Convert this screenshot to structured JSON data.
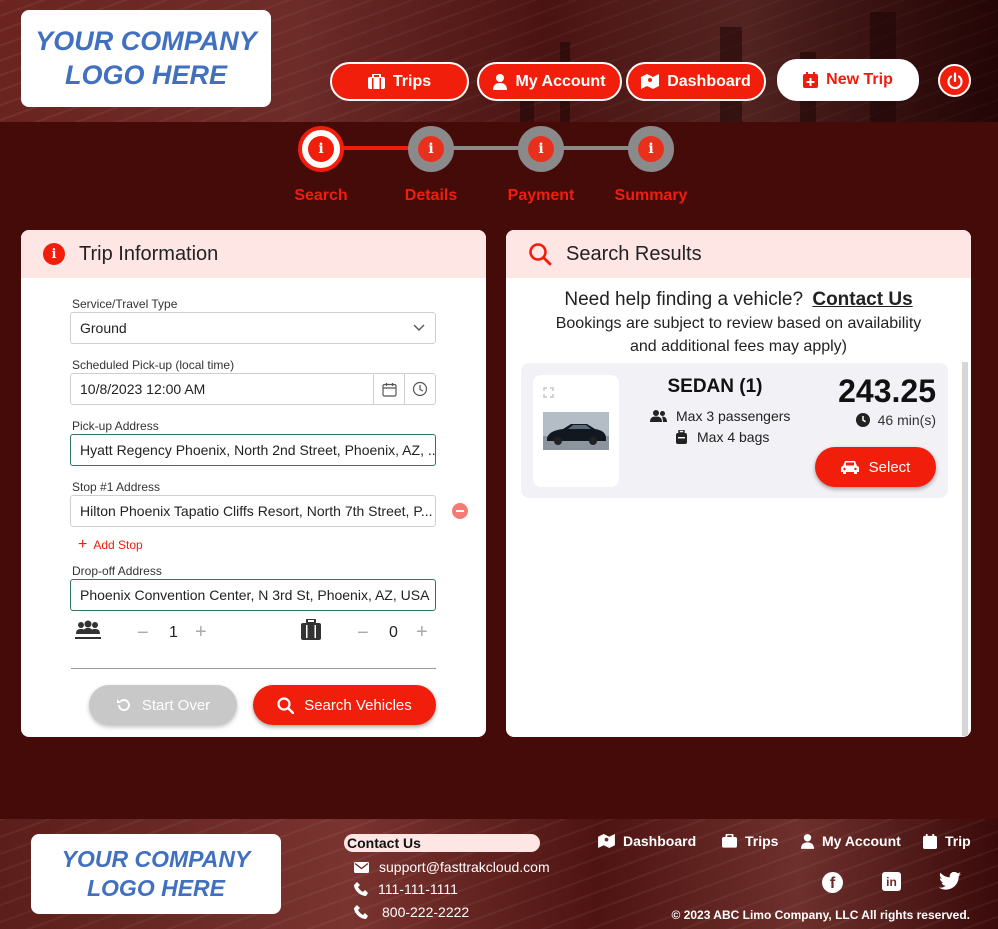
{
  "brand": {
    "logo_line1": "YOUR COMPANY",
    "logo_line2": "LOGO HERE"
  },
  "nav": {
    "trips": "Trips",
    "account": "My Account",
    "dashboard": "Dashboard",
    "new_trip": "New Trip"
  },
  "steps": [
    {
      "label": "Search",
      "state": "active"
    },
    {
      "label": "Details",
      "state": "inactive"
    },
    {
      "label": "Payment",
      "state": "inactive"
    },
    {
      "label": "Summary",
      "state": "inactive"
    }
  ],
  "trip_info": {
    "title": "Trip Information",
    "service_label": "Service/Travel Type",
    "service_value": "Ground",
    "pickup_time_label": "Scheduled Pick-up (local time)",
    "pickup_time_value": "10/8/2023 12:00 AM",
    "pickup_label": "Pick-up Address",
    "pickup_value": "Hyatt Regency Phoenix, North 2nd Street, Phoenix, AZ, ...",
    "stop_label": "Stop #1 Address",
    "stop_value": "Hilton Phoenix Tapatio Cliffs Resort, North 7th Street, P...",
    "add_stop": "Add Stop",
    "dropoff_label": "Drop-off Address",
    "dropoff_value": "Phoenix Convention Center, N 3rd St, Phoenix, AZ, USA",
    "passengers": "1",
    "bags": "0",
    "start_over": "Start Over",
    "search": "Search Vehicles"
  },
  "results": {
    "title": "Search Results",
    "help_text": "Need help finding a vehicle?",
    "contact_link": "Contact Us",
    "note_line1": "Bookings are subject to review based on availability",
    "note_line2": "and additional fees may apply)",
    "vehicle": {
      "name": "SEDAN (1)",
      "passengers": "Max 3 passengers",
      "bags": "Max 4 bags",
      "price": "243.25",
      "duration": "46 min(s)",
      "select": "Select"
    }
  },
  "footer": {
    "contact_title": "Contact Us",
    "email": "support@fasttrakcloud.com",
    "phone1": "111-111-1111",
    "phone2": "800-222-2222",
    "nav_dashboard": "Dashboard",
    "nav_trips": "Trips",
    "nav_account": "My Account",
    "nav_trip": "Trip",
    "copyright": "© 2023 ABC Limo Company, LLC All rights reserved."
  },
  "colors": {
    "accent": "#f01e0a",
    "background": "#450b09",
    "card_header": "#fde6e4",
    "logo_text": "#4270c0"
  }
}
